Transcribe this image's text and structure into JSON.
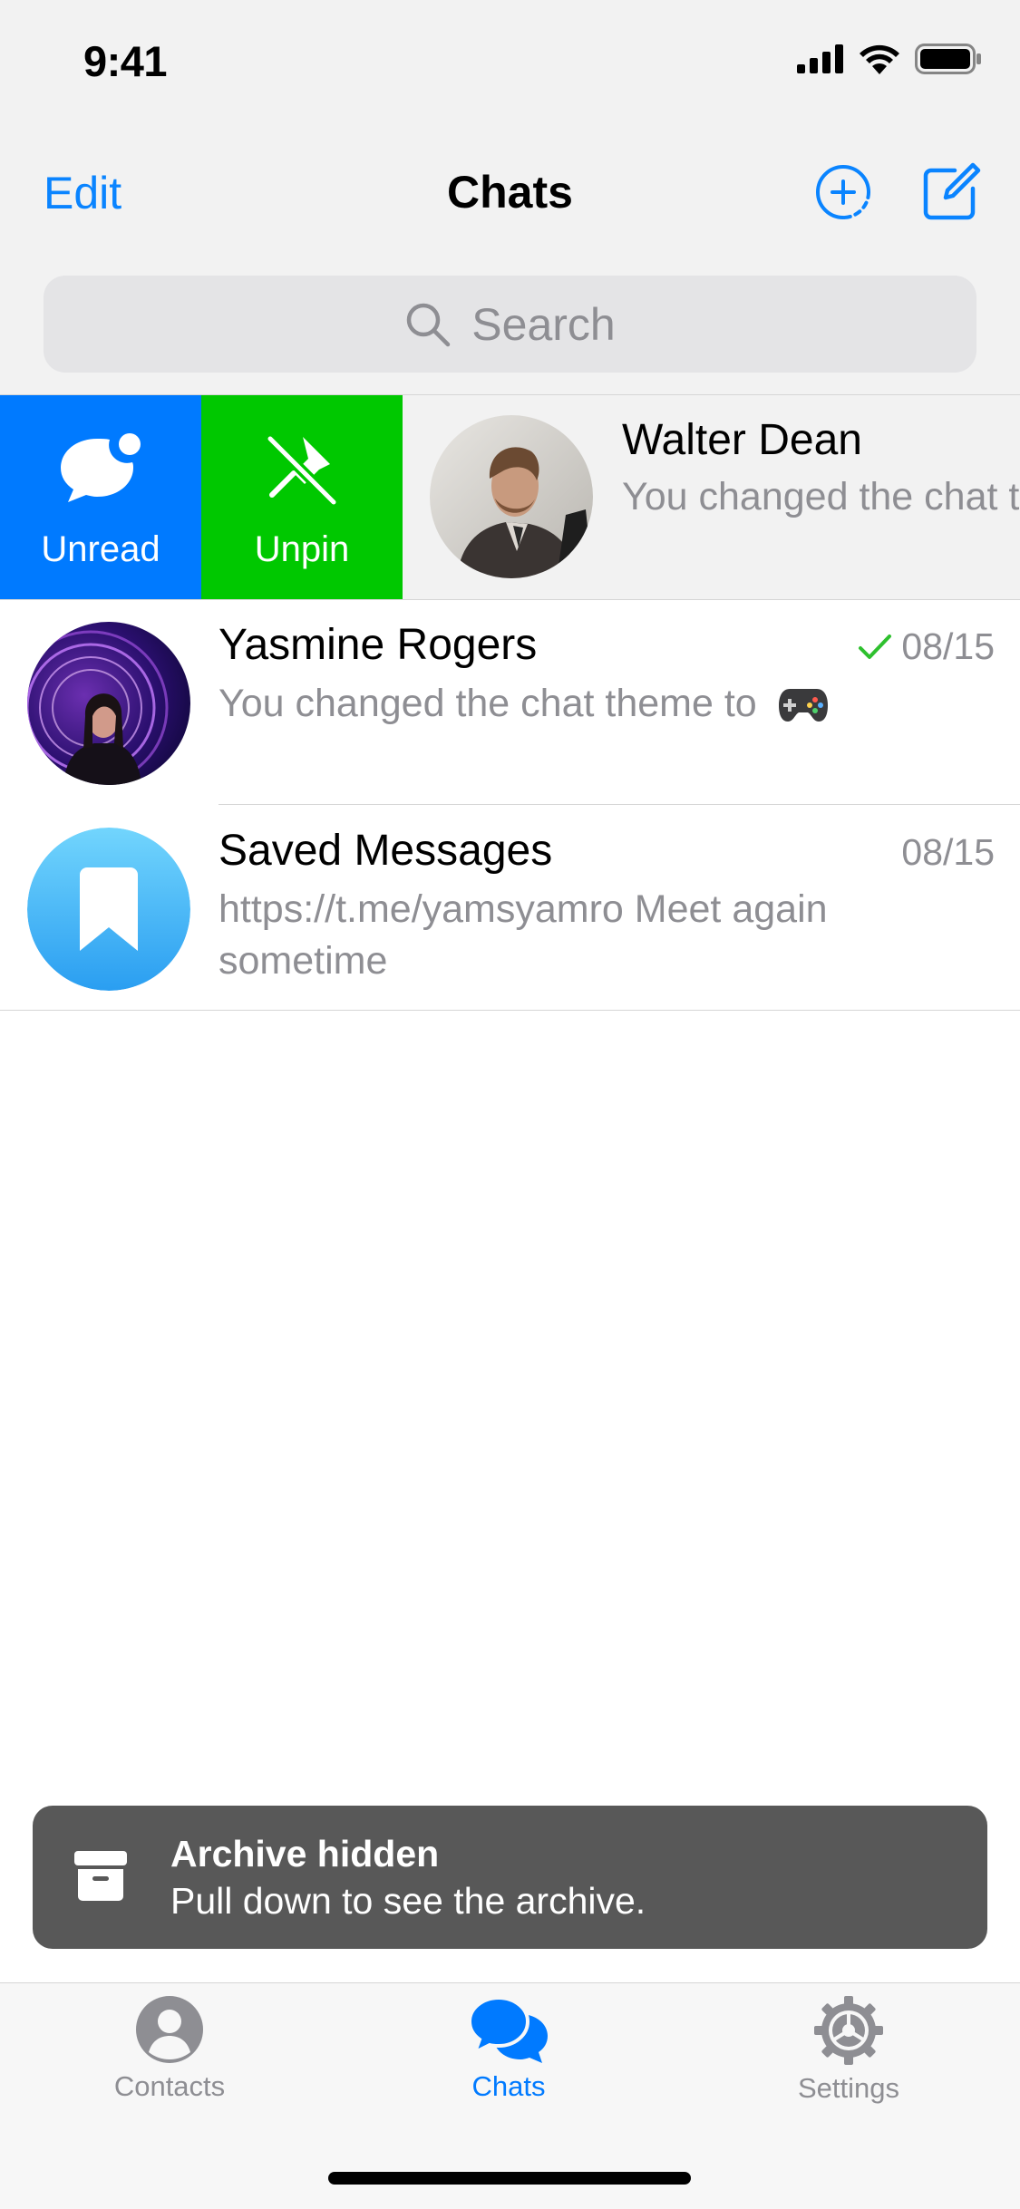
{
  "status_bar": {
    "time": "9:41"
  },
  "nav": {
    "edit": "Edit",
    "title": "Chats"
  },
  "search": {
    "placeholder": "Search"
  },
  "swipe_actions": {
    "unread": "Unread",
    "unpin": "Unpin"
  },
  "chats": [
    {
      "name": "Walter Dean",
      "message": "You changed the chat theme to"
    },
    {
      "name": "Yasmine Rogers",
      "message": "You changed the chat theme to",
      "date": "08/15",
      "status": "read-check"
    },
    {
      "name": "Saved Messages",
      "message": "https://t.me/yamsyamro Meet again sometime",
      "date": "08/15"
    }
  ],
  "toast": {
    "title": "Archive hidden",
    "text": "Pull down to see the archive."
  },
  "tabs": [
    {
      "label": "Contacts",
      "icon": "person-icon"
    },
    {
      "label": "Chats",
      "icon": "chats-icon",
      "selected": true
    },
    {
      "label": "Settings",
      "icon": "gear-icon"
    }
  ],
  "colors": {
    "accent": "#007aff",
    "unpin": "#00c800",
    "check": "#2ec02e"
  }
}
